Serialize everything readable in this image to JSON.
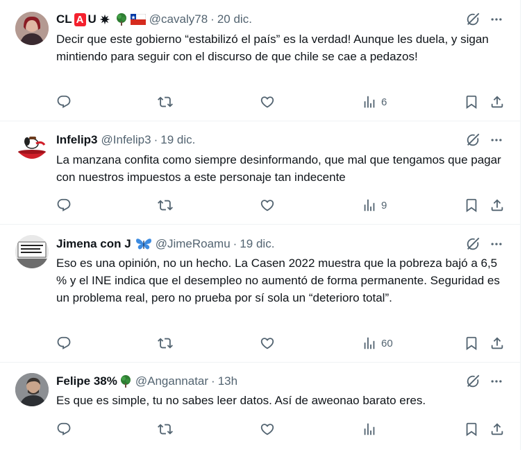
{
  "tweets": [
    {
      "name": "CL",
      "name_letter_badge": "A",
      "name_suffix": "U",
      "handle": "@cavaly78",
      "date": "20 dic.",
      "text": "Decir que este gobierno “estabilizó el país” es la verdad! Aunque les duela, y sigan mintiendo para seguir con el discurso de que chile se cae a pedazos!",
      "views": "6"
    },
    {
      "name": "Infelip3",
      "handle": "@Infelip3",
      "date": "19 dic.",
      "text": "La manzana confita como siempre desinformando, que mal que tengamos que pagar con nuestros impuestos a este personaje tan indecente",
      "views": "9"
    },
    {
      "name": "Jimena con J",
      "handle": "@JimeRoamu",
      "date": "19 dic.",
      "text": "Eso es una opinión, no un hecho. La Casen 2022 muestra que la pobreza bajó a 6,5 % y el INE indica que el desempleo no aumentó de forma permanente. Seguridad es un problema real, pero no prueba por sí sola un “deterioro total”.",
      "views": "60"
    },
    {
      "name": "Felipe 38%",
      "handle": "@Angannatar",
      "date": "13h",
      "text": "Es que es simple, tu no sabes leer datos. Así de aweonao barato eres.",
      "views": ""
    }
  ],
  "icons": {
    "reply": "reply-icon",
    "retweet": "retweet-icon",
    "like": "like-icon",
    "views": "views-icon",
    "bookmark": "bookmark-icon",
    "share": "share-icon",
    "grok": "grok-icon",
    "more": "more-icon"
  },
  "colors": {
    "text": "#0f1419",
    "secondary": "#536471",
    "border": "#eff3f4",
    "badge_red": "#f4212e"
  },
  "dot_separator": "·"
}
